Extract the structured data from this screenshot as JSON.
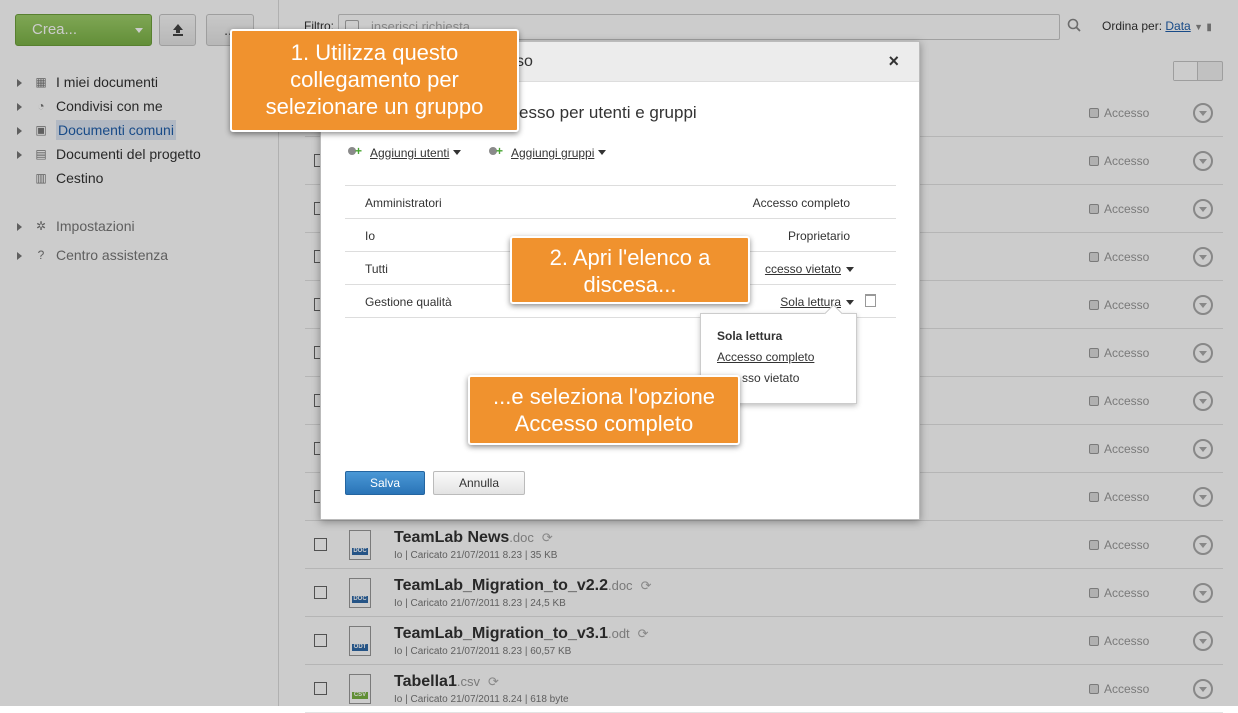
{
  "toolbar": {
    "create_label": "Crea...",
    "more_label": "..."
  },
  "sidebar": {
    "items": [
      {
        "label": "I miei documenti"
      },
      {
        "label": "Condivisi con me"
      },
      {
        "label": "Documenti comuni"
      },
      {
        "label": "Documenti del progetto"
      },
      {
        "label": "Cestino"
      }
    ],
    "settings": "Impostazioni",
    "help": "Centro assistenza"
  },
  "filter": {
    "label": "Filtro:",
    "placeholder": "inserisci richiesta"
  },
  "sort": {
    "label": "Ordina per:",
    "value": "Data"
  },
  "files": [
    {
      "name": "",
      "ext": "",
      "meta": "",
      "access": "Accesso"
    },
    {
      "name": "",
      "ext": "",
      "meta": "",
      "access": "Accesso"
    },
    {
      "name": "",
      "ext": "",
      "meta": "",
      "access": "Accesso"
    },
    {
      "name": "",
      "ext": "",
      "meta": "",
      "access": "Accesso"
    },
    {
      "name": "",
      "ext": "",
      "meta": "",
      "access": "Accesso"
    },
    {
      "name": "",
      "ext": "",
      "meta": "",
      "access": "Accesso"
    },
    {
      "name": "",
      "ext": "",
      "meta": "",
      "access": "Accesso"
    },
    {
      "name": "",
      "ext": "",
      "meta": "",
      "access": "Accesso"
    },
    {
      "name": "",
      "ext": "",
      "meta": "",
      "access": "Accesso"
    },
    {
      "name": "TeamLab News",
      "ext": ".doc",
      "tag": "DOC",
      "meta": "Io | Caricato 21/07/2011 8.23 | 35 KB",
      "access": "Accesso"
    },
    {
      "name": "TeamLab_Migration_to_v2.2",
      "ext": ".doc",
      "tag": "DOC",
      "meta": "Io | Caricato 21/07/2011 8.23 | 24,5 KB",
      "access": "Accesso"
    },
    {
      "name": "TeamLab_Migration_to_v3.1",
      "ext": ".odt",
      "tag": "ODT",
      "meta": "Io | Caricato 21/07/2011 8.23 | 60,57 KB",
      "access": "Accesso"
    },
    {
      "name": "Tabella1",
      "ext": ".csv",
      "tag": "CSV",
      "meta": "Io | Caricato 21/07/2011 8.24 | 618 byte",
      "access": "Accesso"
    }
  ],
  "dialog": {
    "title": "so",
    "subtitle": "esso per utenti e gruppi",
    "close": "×",
    "add_users": "Aggiungi utenti",
    "add_groups": "Aggiungi gruppi",
    "rows": [
      {
        "name": "Amministratori",
        "access": "Accesso completo"
      },
      {
        "name": "Io",
        "access": "Proprietario"
      },
      {
        "name": "Tutti",
        "access": "ccesso vietato"
      },
      {
        "name": "Gestione qualità",
        "access": "Sola lettura"
      }
    ],
    "save": "Salva",
    "cancel": "Annulla"
  },
  "dropdown": {
    "options": [
      "Sola lettura",
      "Accesso completo",
      "sso vietato"
    ]
  },
  "callouts": {
    "c1": "1. Utilizza questo collegamento per selezionare un gruppo",
    "c2": "2. Apri l'elenco a discesa...",
    "c3": "...e seleziona l'opzione Accesso completo"
  },
  "colors": {
    "create_green": "#8cc152",
    "callout_orange": "#f0922e",
    "save_blue": "#2a74b7",
    "link_blue": "#1f5eaa"
  }
}
